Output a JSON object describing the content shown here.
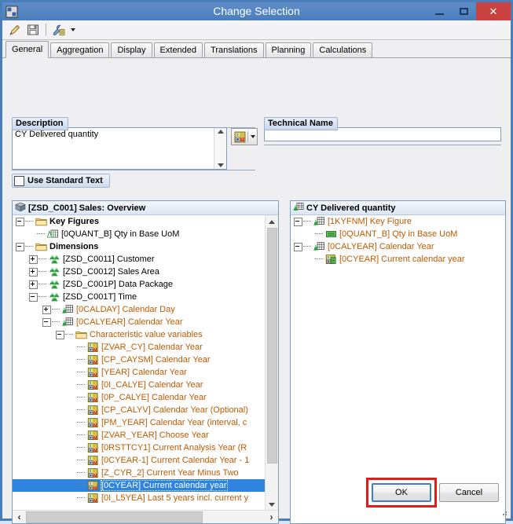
{
  "window": {
    "title": "Change Selection",
    "icon": "query-designer-icon",
    "buttons": {
      "minimize": "minimize-icon",
      "maximize": "maximize-icon",
      "close": "✕"
    }
  },
  "toolbar": {
    "items": [
      {
        "name": "edit-pencil-button",
        "icon": "pencil-icon"
      },
      {
        "name": "save-button",
        "icon": "floppy-disk-icon"
      },
      {
        "name": "properties-button",
        "icon": "wrench-icon",
        "has_dropdown": true
      }
    ]
  },
  "tabs": [
    {
      "label": "General",
      "active": true
    },
    {
      "label": "Aggregation",
      "active": false
    },
    {
      "label": "Display",
      "active": false
    },
    {
      "label": "Extended",
      "active": false
    },
    {
      "label": "Translations",
      "active": false
    },
    {
      "label": "Planning",
      "active": false
    },
    {
      "label": "Calculations",
      "active": false
    }
  ],
  "description": {
    "group_label": "Description",
    "value": "CY Delivered quantity",
    "variable_button_icon": "insert-variable-icon",
    "checkbox": {
      "label": "Use Standard Text",
      "checked": false
    }
  },
  "technical_name": {
    "group_label": "Technical Name",
    "value": "",
    "placeholder": ""
  },
  "left_panel": {
    "header": "[ZSD_C001] Sales: Overview",
    "header_icon": "infoprovider-cube-icon",
    "rows": [
      {
        "depth": 0,
        "twisty": "minus",
        "icon": "folder-icon",
        "label": "Key Figures",
        "style": "bold"
      },
      {
        "depth": 1,
        "twisty": "none",
        "icon": "keyfigure-icon",
        "label": "[0QUANT_B] Qty in Base UoM",
        "style": "normal"
      },
      {
        "depth": 0,
        "twisty": "minus",
        "icon": "folder-icon",
        "label": "Dimensions",
        "style": "bold"
      },
      {
        "depth": 1,
        "twisty": "plus",
        "icon": "dimension-icon",
        "label": "[ZSD_C0011] Customer",
        "style": "normal"
      },
      {
        "depth": 1,
        "twisty": "plus",
        "icon": "dimension-icon",
        "label": "[ZSD_C0012] Sales Area",
        "style": "normal"
      },
      {
        "depth": 1,
        "twisty": "plus",
        "icon": "dimension-icon",
        "label": "[ZSD_C001P] Data Package",
        "style": "normal"
      },
      {
        "depth": 1,
        "twisty": "minus",
        "icon": "dimension-icon",
        "label": "[ZSD_C001T] Time",
        "style": "normal"
      },
      {
        "depth": 2,
        "twisty": "plus",
        "icon": "characteristic-icon",
        "label": "[0CALDAY] Calendar Day",
        "style": "orange"
      },
      {
        "depth": 2,
        "twisty": "minus",
        "icon": "characteristic-icon",
        "label": "[0CALYEAR] Calendar Year",
        "style": "orange"
      },
      {
        "depth": 3,
        "twisty": "minus",
        "icon": "folder-icon",
        "label": "Characteristic value variables",
        "style": "orange"
      },
      {
        "depth": 4,
        "twisty": "none",
        "icon": "variable-icon",
        "label": "[ZVAR_CY] Calendar Year",
        "style": "orange"
      },
      {
        "depth": 4,
        "twisty": "none",
        "icon": "variable-icon",
        "label": "[CP_CAYSM] Calendar Year",
        "style": "orange"
      },
      {
        "depth": 4,
        "twisty": "none",
        "icon": "variable-icon",
        "label": "[YEAR] Calendar Year",
        "style": "orange"
      },
      {
        "depth": 4,
        "twisty": "none",
        "icon": "variable-icon",
        "label": "[0I_CALYE] Calendar Year",
        "style": "orange"
      },
      {
        "depth": 4,
        "twisty": "none",
        "icon": "variable-icon",
        "label": "[0P_CALYE] Calendar Year",
        "style": "orange"
      },
      {
        "depth": 4,
        "twisty": "none",
        "icon": "variable-icon",
        "label": "[CP_CALYV] Calendar Year (Optional)",
        "style": "orange"
      },
      {
        "depth": 4,
        "twisty": "none",
        "icon": "variable-icon",
        "label": "[PM_YEAR] Calendar Year (interval, c",
        "style": "orange"
      },
      {
        "depth": 4,
        "twisty": "none",
        "icon": "variable-icon",
        "label": "[ZVAR_YEAR] Choose Year",
        "style": "orange"
      },
      {
        "depth": 4,
        "twisty": "none",
        "icon": "variable-icon",
        "label": "[0RSTTCY1] Current Analysis Year (R",
        "style": "orange"
      },
      {
        "depth": 4,
        "twisty": "none",
        "icon": "variable-icon",
        "label": "[0CYEAR-1] Current Calendar Year - 1",
        "style": "orange"
      },
      {
        "depth": 4,
        "twisty": "none",
        "icon": "variable-icon",
        "label": "[Z_CYR_2] Current Year Minus Two",
        "style": "orange"
      },
      {
        "depth": 4,
        "twisty": "none",
        "icon": "variable-icon",
        "label": "[0CYEAR] Current calendar year",
        "style": "selected"
      },
      {
        "depth": 4,
        "twisty": "none",
        "icon": "variable-icon",
        "label": "[0I_L5YEA] Last 5 years incl. current y",
        "style": "orange"
      }
    ]
  },
  "right_panel": {
    "header": "CY Delivered quantity",
    "header_icon": "characteristic-icon",
    "rows": [
      {
        "depth": 0,
        "twisty": "minus",
        "icon": "characteristic-icon",
        "label": "[1KYFNM] Key Figure",
        "style": "orange"
      },
      {
        "depth": 1,
        "twisty": "none",
        "icon": "keyfigure-green-icon",
        "label": "[0QUANT_B] Qty in Base UoM",
        "style": "orange"
      },
      {
        "depth": 0,
        "twisty": "minus",
        "icon": "characteristic-icon",
        "label": "[0CALYEAR] Calendar Year",
        "style": "orange"
      },
      {
        "depth": 1,
        "twisty": "none",
        "icon": "variable-used-icon",
        "label": "[0CYEAR] Current calendar year",
        "style": "orange"
      }
    ]
  },
  "footer": {
    "ok_label": "OK",
    "cancel_label": "Cancel",
    "highlight_color": "#e01b1b"
  }
}
